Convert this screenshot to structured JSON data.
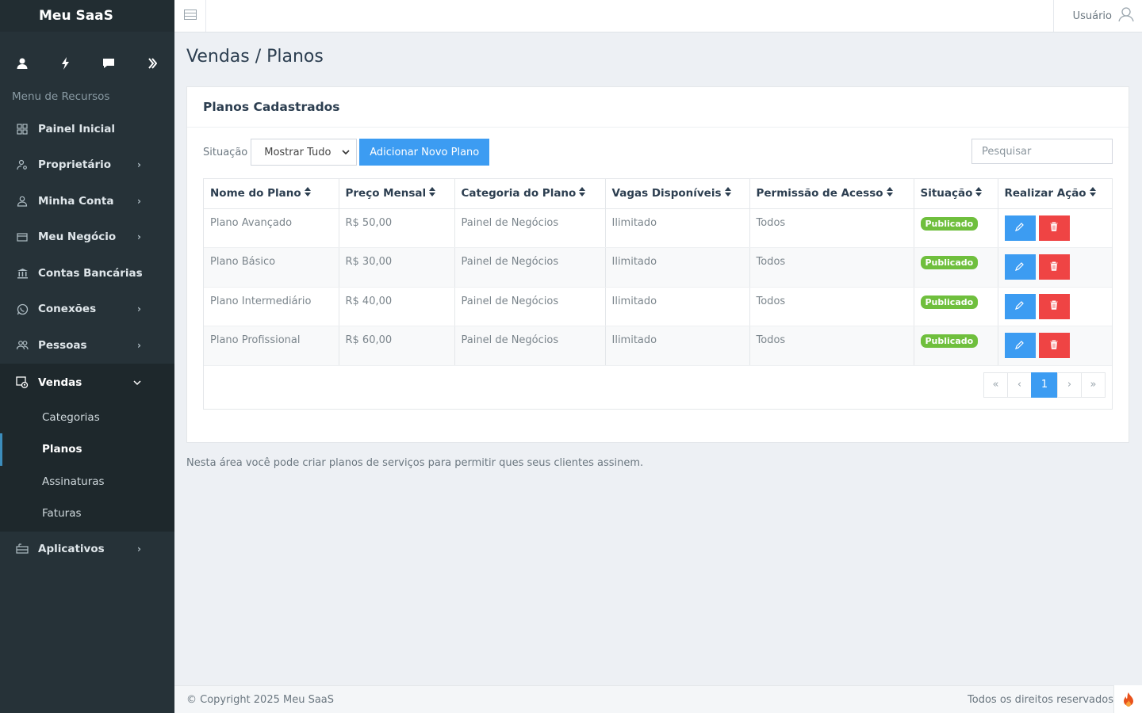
{
  "brand": "Meu SaaS",
  "sidebar": {
    "menu_header": "Menu de Recursos",
    "items": [
      {
        "label": "Painel Inicial"
      },
      {
        "label": "Proprietário"
      },
      {
        "label": "Minha Conta"
      },
      {
        "label": "Meu Negócio"
      },
      {
        "label": "Contas Bancárias"
      },
      {
        "label": "Conexões"
      },
      {
        "label": "Pessoas"
      },
      {
        "label": "Vendas"
      },
      {
        "label": "Aplicativos"
      }
    ],
    "vendas_sub": [
      "Categorias",
      "Planos",
      "Assinaturas",
      "Faturas"
    ]
  },
  "topbar": {
    "user_label": "Usuário"
  },
  "page": {
    "title": "Vendas / Planos",
    "box_title": "Planos Cadastrados",
    "filter_label": "Situação",
    "filter_value": "Mostrar Tudo",
    "add_button": "Adicionar Novo Plano",
    "search_placeholder": "Pesquisar",
    "help_text": "Nesta área você pode criar planos de serviços para permitir ques seus clientes assinem."
  },
  "table": {
    "columns": [
      "Nome do Plano",
      "Preço Mensal",
      "Categoria do Plano",
      "Vagas Disponíveis",
      "Permissão de Acesso",
      "Situação",
      "Realizar Ação"
    ],
    "rows": [
      {
        "name": "Plano Avançado",
        "price": "R$ 50,00",
        "category": "Painel de Negócios",
        "slots": "Ilimitado",
        "access": "Todos",
        "status": "Publicado"
      },
      {
        "name": "Plano Básico",
        "price": "R$ 30,00",
        "category": "Painel de Negócios",
        "slots": "Ilimitado",
        "access": "Todos",
        "status": "Publicado"
      },
      {
        "name": "Plano Intermediário",
        "price": "R$ 40,00",
        "category": "Painel de Negócios",
        "slots": "Ilimitado",
        "access": "Todos",
        "status": "Publicado"
      },
      {
        "name": "Plano Profissional",
        "price": "R$ 60,00",
        "category": "Painel de Negócios",
        "slots": "Ilimitado",
        "access": "Todos",
        "status": "Publicado"
      }
    ]
  },
  "pager": {
    "first": "«",
    "prev": "‹",
    "current": "1",
    "next": "›",
    "last": "»"
  },
  "footer": {
    "copyright": "© Copyright 2025 Meu SaaS",
    "rights": "Todos os direitos reservados"
  },
  "colors": {
    "sidebar": "#263238",
    "primary": "#3c9cf2",
    "danger": "#ef4444",
    "success": "#6fbf3d"
  }
}
